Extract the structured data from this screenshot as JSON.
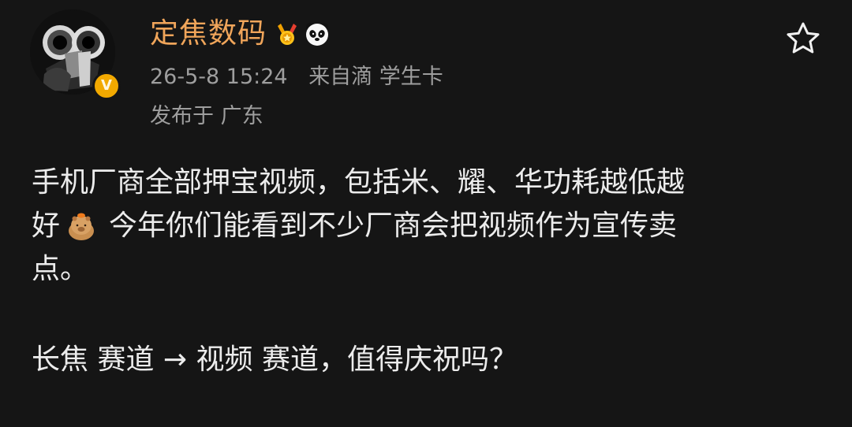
{
  "author": {
    "name": "定焦数码",
    "verified_mark": "V",
    "avatar_icon": "camera-avatar-icon",
    "badges": [
      "medal-icon",
      "panda-icon"
    ]
  },
  "meta": {
    "time": "26-5-8 15:24",
    "source_prefix": "来自滴",
    "source_name": "学生卡",
    "location": "发布于 广东"
  },
  "post": {
    "line1": "手机厂商全部押宝视频，包括米、耀、华功耗越低越",
    "line2_start": "好",
    "line2_emoji": "capybara-emoji-icon",
    "line2_rest": "今年你们能看到不少厂商会把视频作为宣传卖",
    "line3": "点。",
    "line4": "长焦 赛道 → 视频 赛道，值得庆祝吗？"
  },
  "actions": {
    "favorite_icon": "star-icon"
  },
  "colors": {
    "background": "#151515",
    "username": "#f0a55a",
    "meta": "#9e9e9e",
    "text": "#ececec",
    "verified": "#f2a900"
  }
}
